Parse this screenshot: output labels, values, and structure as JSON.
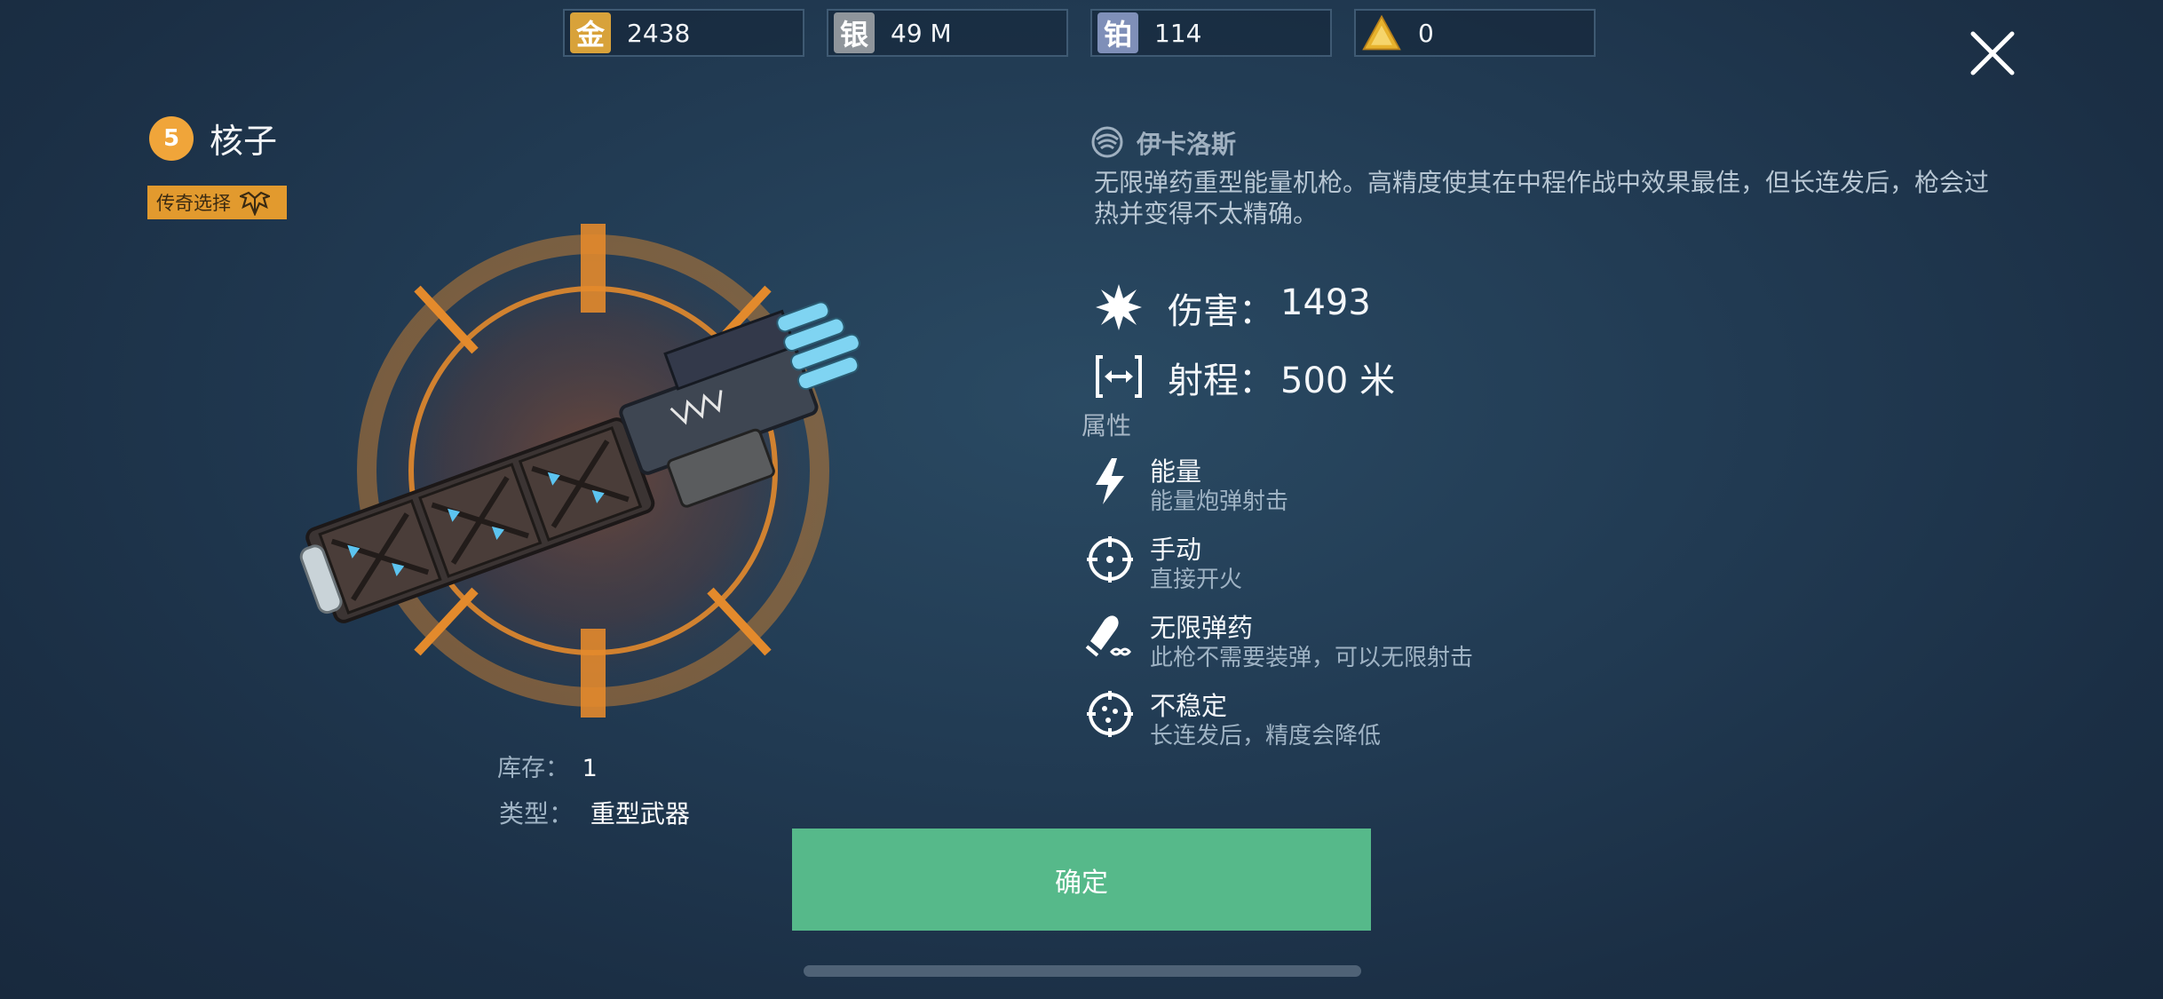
{
  "currencies": [
    {
      "icon": "gold-icon",
      "glyph": "金",
      "value": "2438",
      "color": "#d8a23a"
    },
    {
      "icon": "silver-icon",
      "glyph": "银",
      "value": "49 M",
      "color": "#8f959b"
    },
    {
      "icon": "platinum-icon",
      "glyph": "铂",
      "value": "114",
      "color": "#7f8fb8"
    },
    {
      "icon": "key-icon",
      "glyph": "",
      "value": "0",
      "color": "#e7b22d"
    }
  ],
  "weapon": {
    "level": "5",
    "name": "核子",
    "tag": "传奇选择",
    "stock_label": "库存：",
    "stock_value": "1",
    "type_label": "类型：",
    "type_value": "重型武器"
  },
  "details": {
    "manufacturer": "伊卡洛斯",
    "description": "无限弹药重型能量机枪。高精度使其在中程作战中效果最佳，但长连发后，枪会过热并变得不太精确。",
    "damage_label": "伤害：",
    "damage_value": "1493",
    "range_label": "射程：",
    "range_value": "500 米",
    "attributes_title": "属性",
    "attributes": [
      {
        "icon": "lightning-icon",
        "title": "能量",
        "sub": "能量炮弹射击"
      },
      {
        "icon": "crosshair-icon",
        "title": "手动",
        "sub": "直接开火"
      },
      {
        "icon": "infinite-ammo-icon",
        "title": "无限弹药",
        "sub": "此枪不需要装弹，可以无限射击"
      },
      {
        "icon": "unstable-icon",
        "title": "不稳定",
        "sub": "长连发后，精度会降低"
      }
    ]
  },
  "confirm_label": "确定",
  "colors": {
    "accent_green": "#56b98a",
    "rarity_orange": "#f0a53a"
  }
}
